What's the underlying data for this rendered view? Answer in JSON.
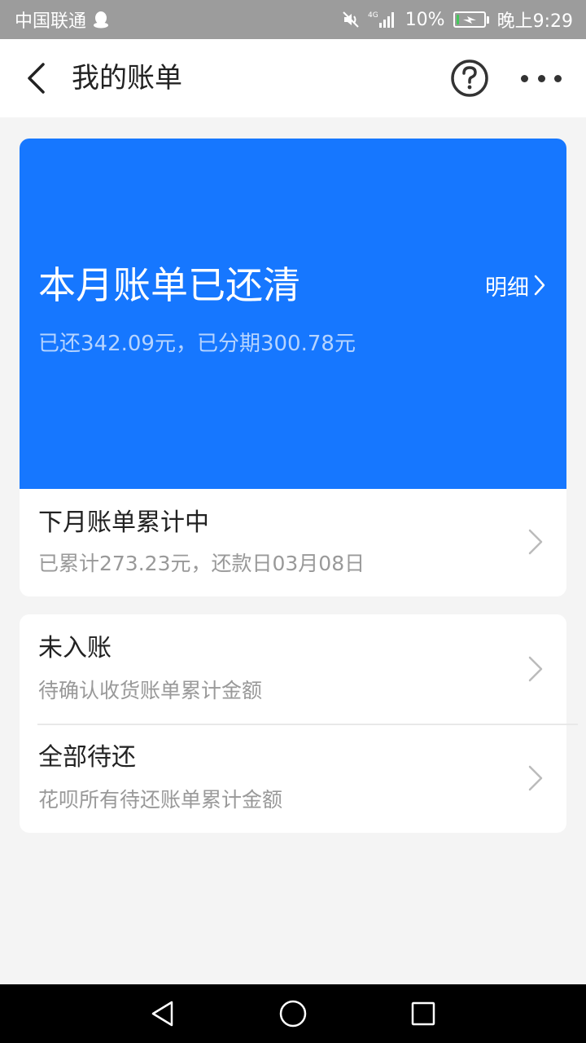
{
  "status_bar": {
    "carrier": "中国联通",
    "network": "4G",
    "battery_percent": "10%",
    "battery_level": 0.1,
    "time": "晚上9:29",
    "icons": [
      "qq-icon",
      "mute-icon",
      "signal-icon",
      "battery-charging-icon"
    ]
  },
  "header": {
    "title": "我的账单",
    "icons": [
      "back-arrow-icon",
      "help-circle-icon",
      "more-dots-icon"
    ]
  },
  "bill": {
    "status_title": "本月账单已还清",
    "detail_label": "明细",
    "summary": "已还342.09元，已分期300.78元",
    "next": {
      "title": "下月账单累计中",
      "subtitle": "已累计273.23元，还款日03月08日"
    }
  },
  "others": [
    {
      "title": "未入账",
      "subtitle": "待确认收货账单累计金额"
    },
    {
      "title": "全部待还",
      "subtitle": "花呗所有待还账单累计金额"
    }
  ],
  "colors": {
    "accent": "#1677ff",
    "page_bg": "#f4f4f4",
    "status_bar_bg": "#9c9c9c",
    "muted_text": "#999999"
  }
}
